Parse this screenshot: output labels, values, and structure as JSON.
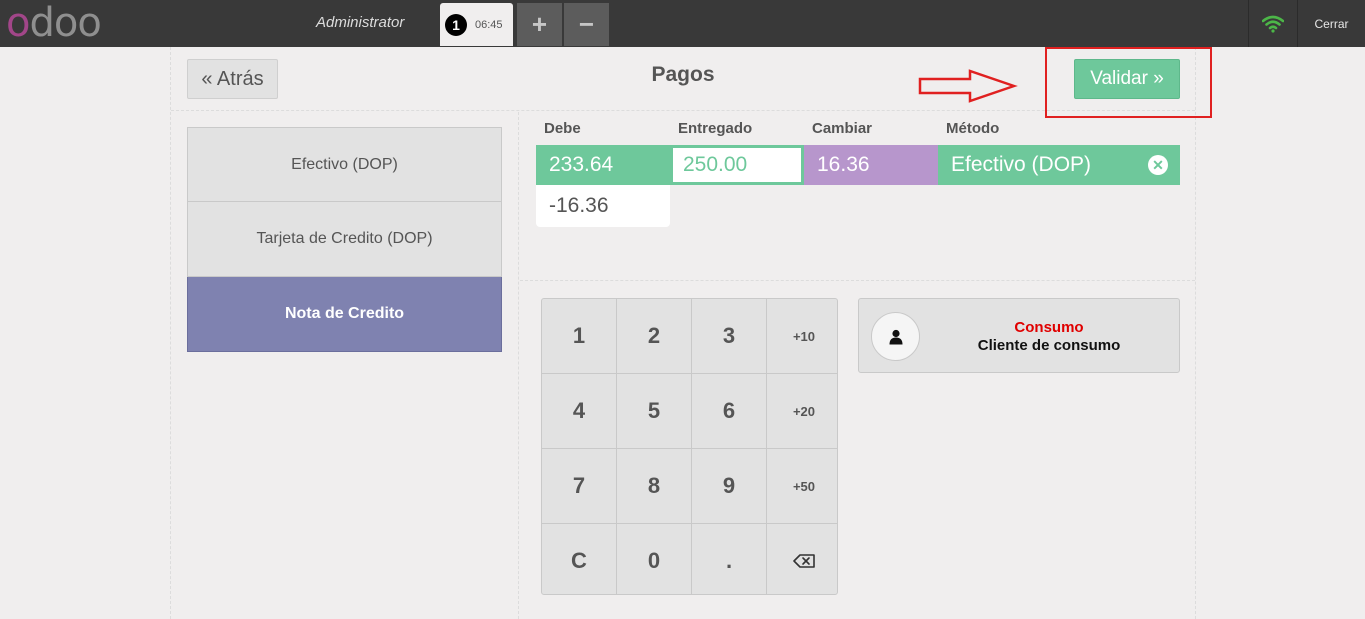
{
  "topbar": {
    "logo_text_first": "o",
    "logo_text_rest": "doo",
    "logo_color_accent": "#a24689",
    "username": "Administrator",
    "order_number": "1",
    "order_time": "06:45",
    "add_order_label": "+",
    "delete_order_label": "−",
    "network_icon": "wifi-icon",
    "network_color": "#4cb648",
    "close_label": "Cerrar"
  },
  "header": {
    "back_label": "« Atrás",
    "title": "Pagos",
    "validate_label": "Validar »"
  },
  "payment_methods": [
    {
      "label": "Efectivo (DOP)",
      "selected": false
    },
    {
      "label": "Tarjeta de Credito (DOP)",
      "selected": false
    },
    {
      "label": "Nota de Credito",
      "selected": true
    }
  ],
  "paymentlines": {
    "headers": {
      "due": "Debe",
      "tendered": "Entregado",
      "change": "Cambiar",
      "method": "Método"
    },
    "line": {
      "due": "233.64",
      "tendered": "250.00",
      "change": "16.36",
      "method": "Efectivo (DOP)"
    },
    "remaining": "-16.36"
  },
  "numpad": {
    "keys": [
      "1",
      "2",
      "3",
      "+10",
      "4",
      "5",
      "6",
      "+20",
      "7",
      "8",
      "9",
      "+50",
      "C",
      "0",
      ".",
      "⌫"
    ]
  },
  "customer": {
    "name": "Consumo",
    "description": "Cliente de consumo",
    "icon": "user-icon"
  },
  "colors": {
    "accent_green": "#6ec89b",
    "change_purple": "#b796cc",
    "selected_method": "#7f82b0",
    "annotation_red": "#e02020"
  }
}
